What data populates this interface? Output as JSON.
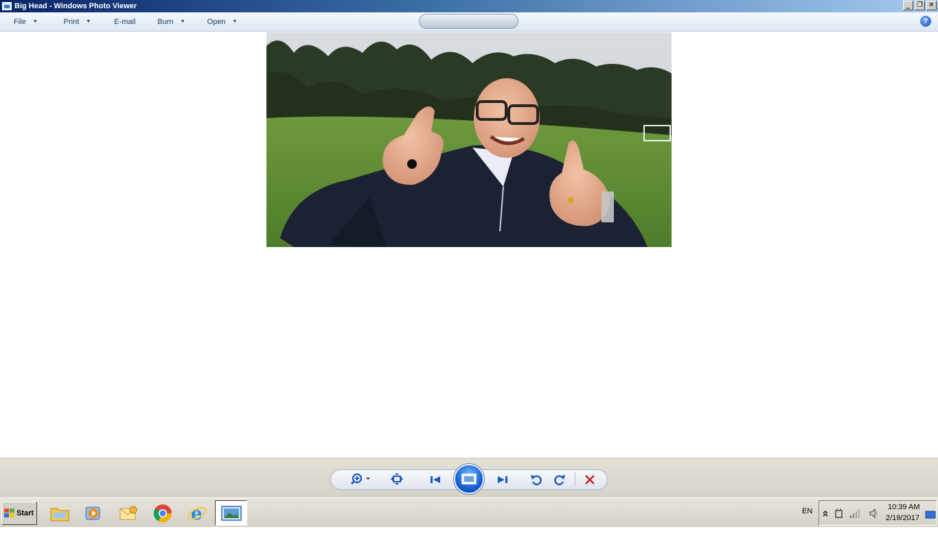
{
  "window": {
    "title": "Big Head - Windows Photo Viewer",
    "buttons": [
      "minimize",
      "restore",
      "close"
    ]
  },
  "menu": {
    "file": "File",
    "print": "Print",
    "email": "E-mail",
    "burn": "Burn",
    "open": "Open",
    "help_glyph": "?"
  },
  "controls": {
    "zoom": "zoom-icon",
    "fit": "actual-size-icon",
    "previous": "previous-icon",
    "slideshow": "slideshow-icon",
    "next": "next-icon",
    "rotate_ccw": "rotate-counterclockwise-icon",
    "rotate_cw": "rotate-clockwise-icon",
    "delete": "delete-icon"
  },
  "taskbar": {
    "start_label": "Start",
    "apps": [
      "file-explorer-icon",
      "media-player-icon",
      "outlook-icon",
      "chrome-icon",
      "internet-explorer-icon",
      "photo-viewer-icon"
    ],
    "language": "EN",
    "time": "10:39 AM",
    "date": "2/19/2017"
  },
  "colors": {
    "titlebar_start": "#0a246a",
    "titlebar_end": "#a6caf0",
    "accent": "#1a66d8",
    "delete_red": "#c41e1e"
  }
}
